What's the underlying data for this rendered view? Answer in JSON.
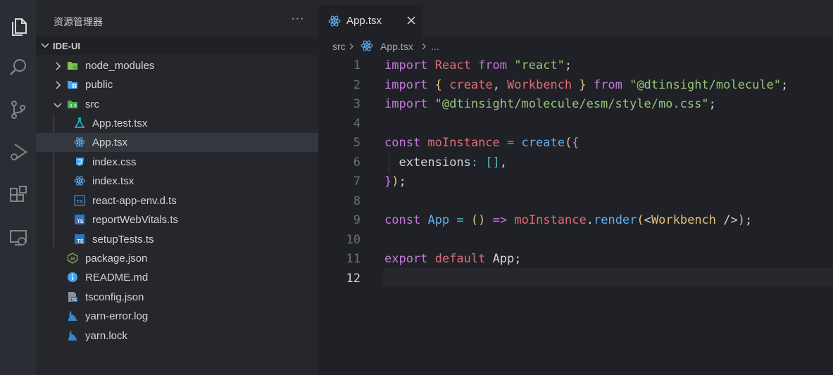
{
  "activity_bar": {
    "items": [
      {
        "icon": "files-icon",
        "active": true
      },
      {
        "icon": "search-icon",
        "active": false
      },
      {
        "icon": "source-control-icon",
        "active": false
      },
      {
        "icon": "run-debug-icon",
        "active": false
      },
      {
        "icon": "extensions-icon",
        "active": false
      },
      {
        "icon": "remote-explorer-icon",
        "active": false
      }
    ]
  },
  "sidebar": {
    "title": "资源管理器",
    "more_label": "···",
    "section_label": "IDE-UI",
    "tree": [
      {
        "label": "node_modules",
        "icon": "folder-node-icon"
      },
      {
        "label": "public",
        "icon": "folder-public-icon"
      },
      {
        "label": "src",
        "icon": "folder-src-icon"
      },
      {
        "label": "App.test.tsx",
        "icon": "test-flask-icon"
      },
      {
        "label": "App.tsx",
        "icon": "react-icon"
      },
      {
        "label": "index.css",
        "icon": "css-icon"
      },
      {
        "label": "index.tsx",
        "icon": "react-icon"
      },
      {
        "label": "react-app-env.d.ts",
        "icon": "typescript-def-icon"
      },
      {
        "label": "reportWebVitals.ts",
        "icon": "typescript-icon"
      },
      {
        "label": "setupTests.ts",
        "icon": "typescript-icon"
      },
      {
        "label": "package.json",
        "icon": "nodejs-icon"
      },
      {
        "label": "README.md",
        "icon": "info-icon"
      },
      {
        "label": "tsconfig.json",
        "icon": "tsconfig-icon"
      },
      {
        "label": "yarn-error.log",
        "icon": "yarn-icon"
      },
      {
        "label": "yarn.lock",
        "icon": "yarn-icon"
      }
    ]
  },
  "tabs": [
    {
      "label": "App.tsx",
      "icon": "react-icon",
      "active": true
    }
  ],
  "breadcrumb": {
    "folder": "src",
    "file": "App.tsx",
    "more": "..."
  },
  "editor": {
    "line_numbers": [
      "1",
      "2",
      "3",
      "4",
      "5",
      "6",
      "7",
      "8",
      "9",
      "10",
      "11",
      "12"
    ],
    "current_line": 12,
    "tokens": {
      "l1": [
        "import",
        " React ",
        "from",
        " \"react\"",
        ";"
      ],
      "l2": [
        "import",
        " { ",
        "create",
        ", ",
        "Workbench",
        " } ",
        "from",
        " \"@dtinsight/molecule\"",
        ";"
      ],
      "l3": [
        "import",
        " \"@dtinsight/molecule/esm/style/mo.css\"",
        ";"
      ],
      "l5": [
        "const",
        " moInstance ",
        "=",
        " ",
        "create",
        "(",
        "{"
      ],
      "l6": [
        "  extensions",
        ":",
        " ",
        "[]",
        ","
      ],
      "l7": [
        "}",
        ")",
        ";"
      ],
      "l9": [
        "const",
        " ",
        "App",
        " ",
        "=",
        " ",
        "()",
        " ",
        "=>",
        " ",
        "moInstance",
        ".",
        "render",
        "(",
        "<",
        "Workbench",
        " />",
        ")",
        ";"
      ],
      "l11": [
        "export",
        " ",
        "default",
        " App;"
      ]
    }
  },
  "colors": {
    "keyword": "#c678dd",
    "variable": "#e06c75",
    "string": "#98c379",
    "function": "#61afef",
    "operator": "#56b6c2",
    "component": "#e5c07b"
  }
}
